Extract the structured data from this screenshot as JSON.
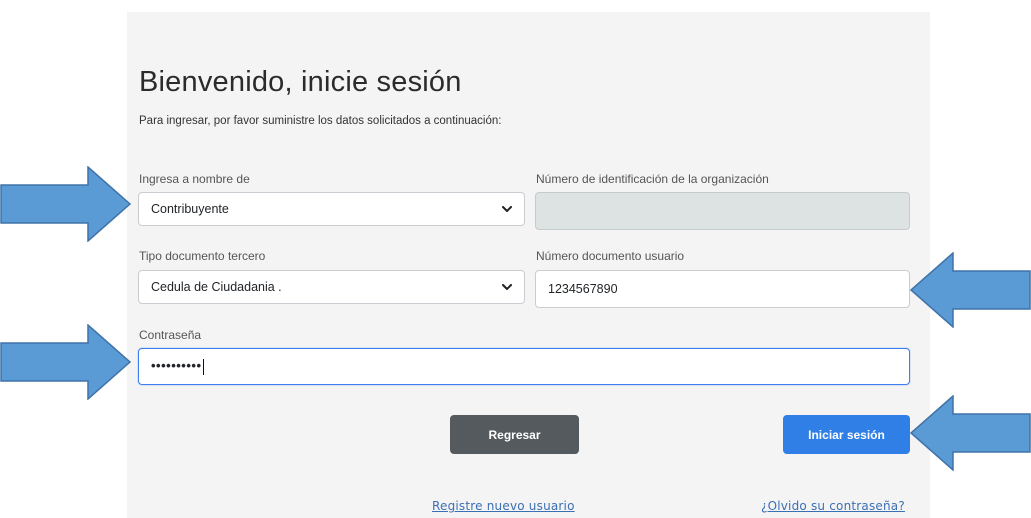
{
  "page": {
    "title": "Bienvenido, inicie sesión",
    "subtitle": "Para ingresar, por favor suministre los datos solicitados a continuación:"
  },
  "form": {
    "on_behalf": {
      "label": "Ingresa a nombre de",
      "value": "Contribuyente"
    },
    "org_id": {
      "label": "Número de identificación de la organización",
      "value": ""
    },
    "doc_type": {
      "label": "Tipo documento tercero",
      "value": "Cedula de Ciudadania ."
    },
    "user_doc": {
      "label": "Número documento usuario",
      "value": "1234567890"
    },
    "password": {
      "label": "Contraseña",
      "value": "••••••••••"
    }
  },
  "buttons": {
    "back": "Regresar",
    "login": "Iniciar sesión"
  },
  "links": {
    "register": "Registre nuevo usuario",
    "forgot": "¿Olvido su contraseña?"
  },
  "icons": {
    "select_chevron": "chevron-down-icon",
    "annotation_arrow": "arrow-icon"
  },
  "colors": {
    "primary": "#2f7fe6",
    "secondary": "#545a5e",
    "arrow_fill": "#5b9bd5",
    "arrow_stroke": "#3f73a8"
  }
}
